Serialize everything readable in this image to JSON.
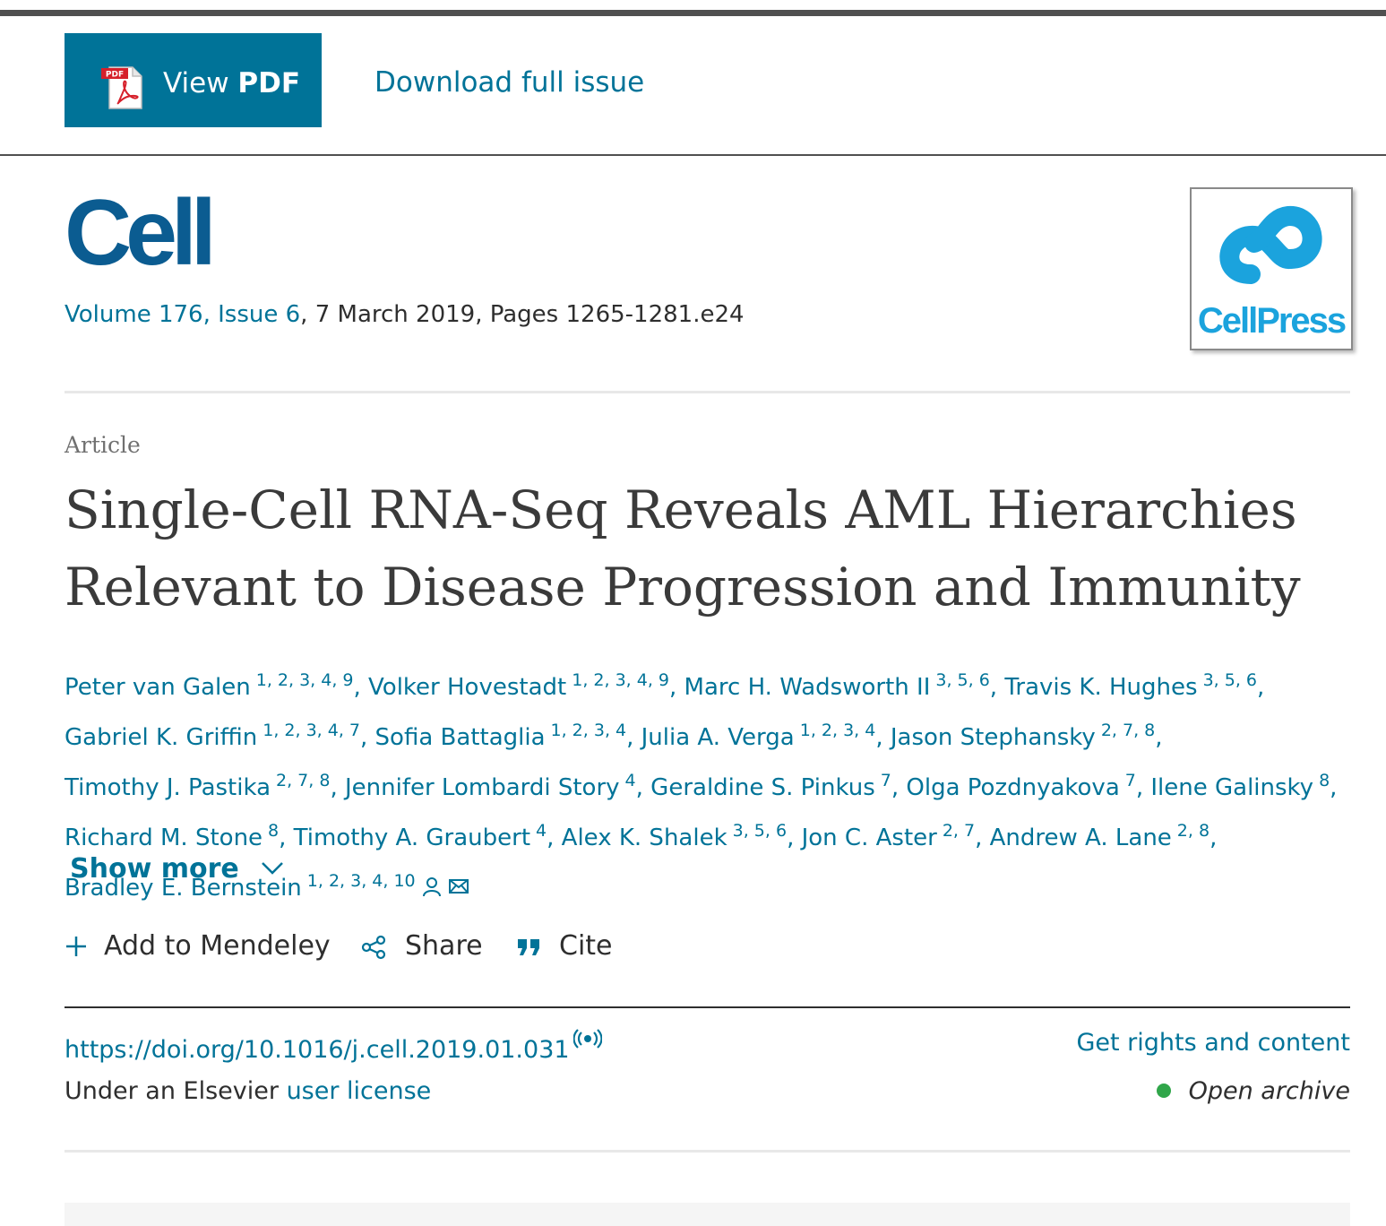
{
  "toolbar": {
    "pdf_button_prefix": "View ",
    "pdf_button_bold": "PDF",
    "pdf_icon_text": "PDF",
    "download_label": "Download full issue"
  },
  "journal": {
    "logo_text": "Cell",
    "volume_issue": "Volume 176, Issue 6",
    "date_pages": ", 7 March 2019, Pages 1265-1281.e24",
    "publisher_logo_text": "CellPress"
  },
  "article": {
    "type": "Article",
    "title": "Single-Cell RNA-Seq Reveals AML Hierarchies Relevant to Disease Progression and Immunity"
  },
  "authors": [
    {
      "name": "Peter van Galen",
      "aff": "1, 2, 3, 4, 9"
    },
    {
      "name": "Volker Hovestadt",
      "aff": "1, 2, 3, 4, 9"
    },
    {
      "name": "Marc H. Wadsworth II",
      "aff": "3, 5, 6"
    },
    {
      "name": "Travis K. Hughes",
      "aff": "3, 5, 6"
    },
    {
      "name": "Gabriel K. Griffin",
      "aff": "1, 2, 3, 4, 7"
    },
    {
      "name": "Sofia Battaglia",
      "aff": "1, 2, 3, 4"
    },
    {
      "name": "Julia A. Verga",
      "aff": "1, 2, 3, 4"
    },
    {
      "name": "Jason Stephansky",
      "aff": "2, 7, 8"
    },
    {
      "name": "Timothy J. Pastika",
      "aff": "2, 7, 8"
    },
    {
      "name": "Jennifer Lombardi Story",
      "aff": "4"
    },
    {
      "name": "Geraldine S. Pinkus",
      "aff": "7"
    },
    {
      "name": "Olga Pozdnyakova",
      "aff": "7"
    },
    {
      "name": "Ilene Galinsky",
      "aff": "8"
    },
    {
      "name": "Richard M. Stone",
      "aff": "8"
    },
    {
      "name": "Timothy A. Graubert",
      "aff": "4"
    },
    {
      "name": "Alex K. Shalek",
      "aff": "3, 5, 6"
    },
    {
      "name": "Jon C. Aster",
      "aff": "2, 7"
    },
    {
      "name": "Andrew A. Lane",
      "aff": "2, 8"
    },
    {
      "name": "Bradley E. Bernstein",
      "aff": "1, 2, 3, 4, 10"
    }
  ],
  "show_more_label": "Show more",
  "actions": {
    "mendeley": "Add to Mendeley",
    "share": "Share",
    "cite": "Cite"
  },
  "doi": "https://doi.org/10.1016/j.cell.2019.01.031",
  "rights_label": "Get rights and content",
  "license": {
    "prefix": "Under an Elsevier ",
    "link": "user license"
  },
  "access": {
    "label": "Open archive",
    "dot_color": "#30a64a"
  },
  "colors": {
    "link": "#007398",
    "journal_logo": "#0b5c91",
    "cellpress": "#1ba3dd"
  }
}
